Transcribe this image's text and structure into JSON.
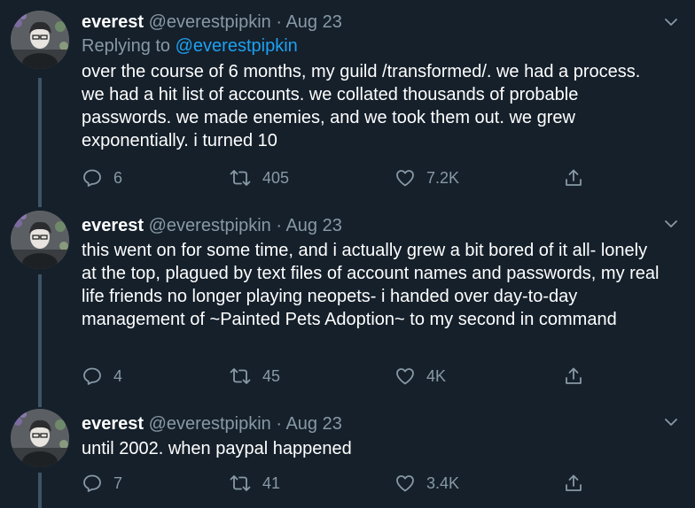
{
  "tweets": [
    {
      "name": "everest",
      "handle": "@everestpipkin",
      "separator": "·",
      "date": "Aug 23",
      "replying_prefix": "Replying to ",
      "replying_to": "@everestpipkin",
      "text": "over the course of 6 months, my guild /transformed/. we had a process. we had a hit list of accounts. we collated thousands of probable passwords. we made enemies, and we took them out. we grew exponentially. i turned 10",
      "replies": "6",
      "retweets": "405",
      "likes": "7.2K"
    },
    {
      "name": "everest",
      "handle": "@everestpipkin",
      "separator": "·",
      "date": "Aug 23",
      "text": "this went on for some time, and i actually grew a bit bored of it all- lonely at the top, plagued by text files of account names and passwords, my real life friends no longer playing neopets- i handed over day-to-day management of ~Painted Pets Adoption~ to my second in command",
      "replies": "4",
      "retweets": "45",
      "likes": "4K"
    },
    {
      "name": "everest",
      "handle": "@everestpipkin",
      "separator": "·",
      "date": "Aug 23",
      "text": "until 2002. when paypal happened",
      "replies": "7",
      "retweets": "41",
      "likes": "3.4K"
    }
  ],
  "icons": {
    "reply": "reply-icon",
    "retweet": "retweet-icon",
    "like": "heart-icon",
    "share": "share-icon",
    "menu": "chevron-down-icon"
  },
  "colors": {
    "background": "#15202b",
    "text_primary": "#ffffff",
    "text_secondary": "#8899a6",
    "link": "#1da1f2",
    "thread_line": "#3d5466"
  }
}
